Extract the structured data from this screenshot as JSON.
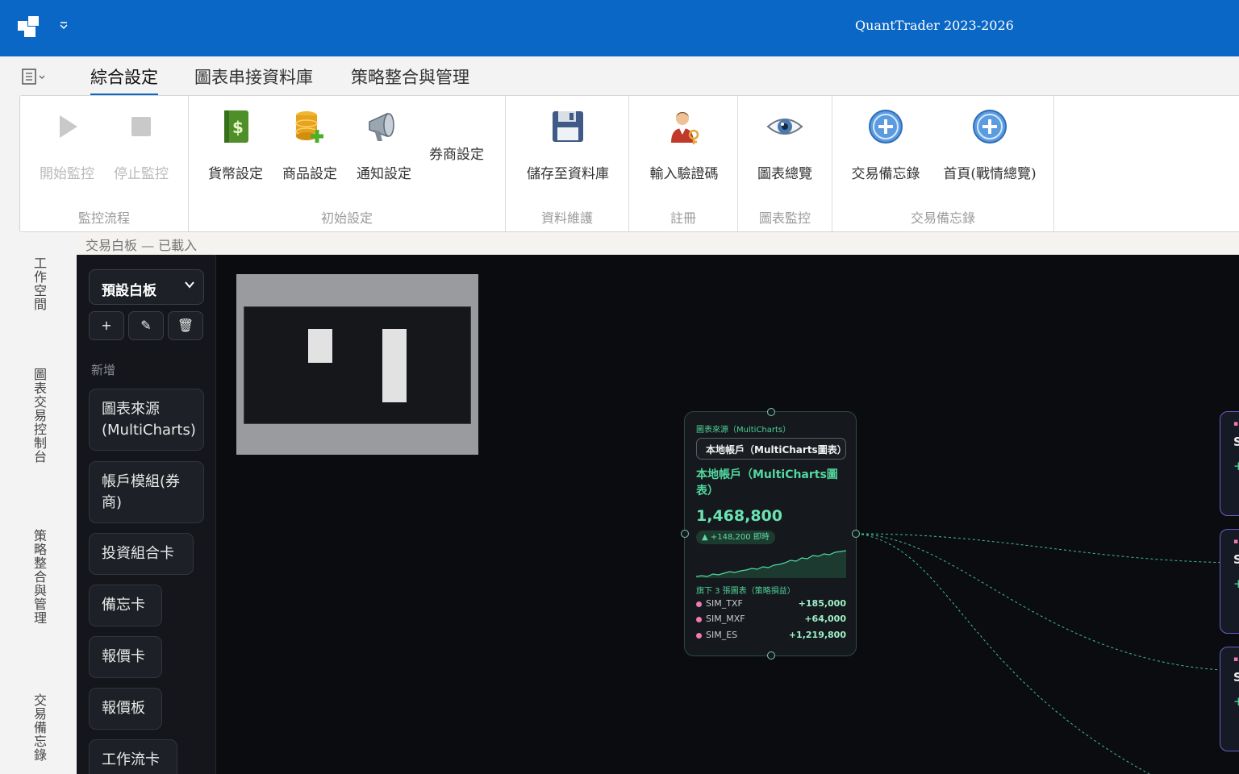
{
  "window": {
    "title": "QuantTrader 2023-2026"
  },
  "ribbon_tabs": [
    {
      "label": "綜合設定",
      "active": true
    },
    {
      "label": "圖表串接資料庫",
      "active": false
    },
    {
      "label": "策略整合與管理",
      "active": false
    }
  ],
  "ribbon_groups": {
    "monitor": {
      "label": "監控流程",
      "buttons": [
        {
          "label": "開始監控",
          "icon": "play-icon",
          "enabled": false
        },
        {
          "label": "停止監控",
          "icon": "stop-icon",
          "enabled": false
        }
      ]
    },
    "initial": {
      "label": "初始設定",
      "buttons": [
        {
          "label": "貨幣設定",
          "icon": "money-icon"
        },
        {
          "label": "商品設定",
          "icon": "database-add-icon"
        },
        {
          "label": "通知設定",
          "icon": "megaphone-icon"
        },
        {
          "label": "券商設定",
          "icon": ""
        }
      ]
    },
    "maintenance": {
      "label": "資料維護",
      "buttons": [
        {
          "label": "儲存至資料庫",
          "icon": "floppy-disk-icon"
        }
      ]
    },
    "register": {
      "label": "註冊",
      "buttons": [
        {
          "label": "輸入驗證碼",
          "icon": "user-key-icon"
        }
      ]
    },
    "chart_monitor": {
      "label": "圖表監控",
      "buttons": [
        {
          "label": "圖表總覽",
          "icon": "eye-icon"
        }
      ]
    },
    "memo": {
      "label": "交易備忘錄",
      "buttons": [
        {
          "label": "交易備忘錄",
          "icon": "plus-circle-icon"
        },
        {
          "label": "首頁(戰情總覽)",
          "icon": "plus-circle-icon"
        }
      ]
    }
  },
  "status": {
    "text": "交易白板 — 已載入"
  },
  "left_nav": [
    {
      "label": "工作空間"
    },
    {
      "label": "圖表交易控制台"
    },
    {
      "label": "策略整合與管理"
    },
    {
      "label": "交易備忘錄"
    }
  ],
  "palette": {
    "board_select": "預設白板",
    "actions": {
      "add": "+",
      "edit": "✎",
      "delete": "🗑"
    },
    "add_label": "新增",
    "items": [
      {
        "label": "圖表來源(MultiCharts)"
      },
      {
        "label": "帳戶模組(券商)"
      },
      {
        "label": "投資組合卡"
      },
      {
        "label": "備忘卡"
      },
      {
        "label": "報價卡"
      },
      {
        "label": "報價板"
      },
      {
        "label": "工作流卡"
      }
    ]
  },
  "node_card": {
    "type_label": "圖表來源（MultiCharts）",
    "select_value": "本地帳戶（MultiCharts圖表）",
    "title": "本地帳戶（MultiCharts圖表）",
    "value": "1,468,800",
    "delta": "▲ +148,200 即時",
    "sparkline": [
      10,
      11,
      10,
      13,
      12,
      14,
      16,
      15,
      17,
      18,
      20,
      19,
      22,
      21,
      24,
      25,
      27,
      30,
      29,
      33,
      32,
      36,
      35,
      38,
      37,
      40,
      41,
      42
    ],
    "subheading": "旗下 3 張圖表（策略損益）",
    "rows": [
      {
        "name": "SIM_TXF",
        "value": "+185,000"
      },
      {
        "name": "SIM_MXF",
        "value": "+64,000"
      },
      {
        "name": "SIM_ES",
        "value": "+1,219,800"
      }
    ]
  },
  "colors": {
    "titlebar": "#0a67c5",
    "accent_green": "#52d8a0",
    "canvas_bg": "#0b0c10",
    "edge": "#3fbf8f",
    "side_card_border": "#6b5cc9"
  }
}
